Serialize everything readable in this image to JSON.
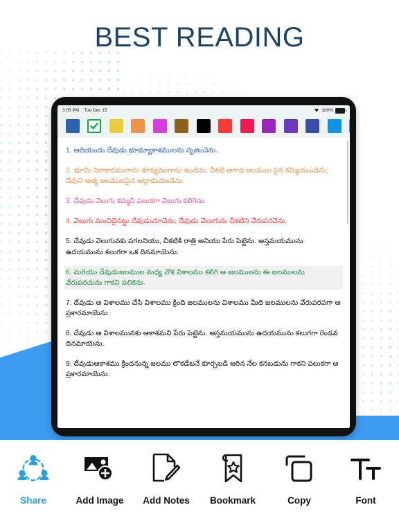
{
  "page": {
    "title": "BEST READING",
    "title_color": "#1f4363",
    "accent_blue": "#3d9bf0"
  },
  "device": {
    "status_bar": {
      "time": "3:05 PM",
      "date": "Tue Dec 15",
      "battery_percent": "100%",
      "wifi_icon": "wifi-icon",
      "battery_icon": "battery-icon"
    }
  },
  "palette": {
    "selected_index": 1,
    "checkmark_color": "#17a24a",
    "swatches": [
      {
        "name": "blue",
        "color": "#2A62AE",
        "selected": false
      },
      {
        "name": "green",
        "color": "#17a24a",
        "selected": true
      },
      {
        "name": "yellow",
        "color": "#E8CB3E",
        "selected": false
      },
      {
        "name": "orange",
        "color": "#EE924B",
        "selected": false
      },
      {
        "name": "magenta",
        "color": "#D63EE0",
        "selected": false
      },
      {
        "name": "brown",
        "color": "#8A611F",
        "selected": false
      },
      {
        "name": "black",
        "color": "#000000",
        "selected": false
      },
      {
        "name": "red",
        "color": "#F8393A",
        "selected": false
      },
      {
        "name": "crimson",
        "color": "#ED1A54",
        "selected": false
      },
      {
        "name": "purple",
        "color": "#9A25BC",
        "selected": false
      },
      {
        "name": "violet",
        "color": "#6B39BE",
        "selected": false
      },
      {
        "name": "indigo",
        "color": "#3B4BA8",
        "selected": false
      },
      {
        "name": "sky-blue",
        "color": "#0C94E2",
        "selected": false
      },
      {
        "name": "light-blue",
        "color": "#13A7EB",
        "selected": false
      }
    ]
  },
  "reader": {
    "verses": [
      {
        "number": "1",
        "text": "1. ఆదియందు దేవుడు భూమ్యాకాశములను సృజించెను.",
        "color": "#2A62AE",
        "highlight": false
      },
      {
        "number": "2",
        "text": "2. భూమి నిరాకారముగాను శూన్యముగాను ఉండెను; చీకటి అగాధ జలముల పైన కమ్మియుండెను; దేవుని ఆత్మ జలములపైన అల్లాడుచుండెను.",
        "color": "#EE924B",
        "highlight": false
      },
      {
        "number": "3",
        "text": "3. దేవుడు వెలుగు కమ్మని  పలుకగా వెలుగు కలిగెను.",
        "color": "#ED5B8E",
        "highlight": false
      },
      {
        "number": "4",
        "text": "4. వెలుగు మంచిదైనట్టు దేవుడుచూచెను; దేవుడు వెలుగును చీకటిని వేరుపరచెను.",
        "color": "#F8393A",
        "highlight": false
      },
      {
        "number": "5",
        "text": "5. దేవుడు వెలుగునకు పగలనియు, చీకటికి రాత్రి అనియు పేరు పెట్టెను. అస్తమయమును ఉదయమును కలుగగా ఒక దినమాయెను.",
        "color": "#111111",
        "highlight": false
      },
      {
        "number": "6",
        "text": "6. మరియు దేవుడుజలముల మధ్య నొక విశాలము కలిగి ఆ జలములను ఈ జలములను వేరుపరచును గాకని పలికెను.",
        "color": "#1E8A4C",
        "highlight": true
      },
      {
        "number": "7",
        "text": "7. దేవుడు ఆ విశాలము చేసి విశాలము క్రింది జలములను విశాలము మీది జలములను వేరుపరపగా ఆ ప్రకారమాయెను.",
        "color": "#111111",
        "highlight": false
      },
      {
        "number": "8",
        "text": "8. దేవుడు ఆ విశాలమునకు ఆకాశమని పేరు పెట్టెను. అస్తమయమును ఉదయమును కలుగగా రెండవ దినమాయెను.",
        "color": "#111111",
        "highlight": false
      },
      {
        "number": "9",
        "text": "9. దేవుడుఆకాశము క్రిందనున్న జలము లొకడేటనే కూర్చబడి ఆరిన నేల కనబడును గాకని పలుకగా ఆ ప్రకారమాయెను.",
        "color": "#111111",
        "highlight": false
      }
    ]
  },
  "toolbar": {
    "items": [
      {
        "label": "Share",
        "icon": "share-people-icon",
        "active": true
      },
      {
        "label": "Add Image",
        "icon": "add-image-icon",
        "active": false
      },
      {
        "label": "Add Notes",
        "icon": "add-notes-icon",
        "active": false
      },
      {
        "label": "Bookmark",
        "icon": "bookmark-star-icon",
        "active": false
      },
      {
        "label": "Copy",
        "icon": "copy-icon",
        "active": false
      },
      {
        "label": "Font",
        "icon": "font-size-icon",
        "active": false
      }
    ],
    "active_color": "#2e9fd4"
  }
}
